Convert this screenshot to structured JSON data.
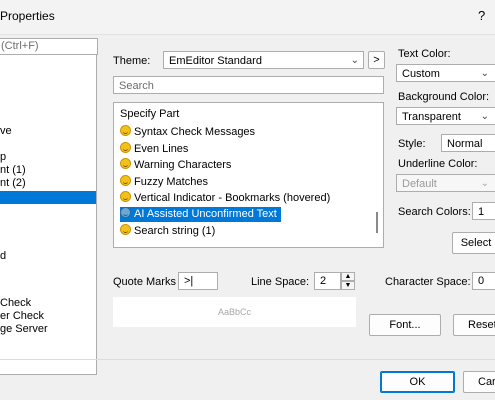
{
  "window": {
    "title": "Properties",
    "help": "?"
  },
  "left_panel": {
    "search_placeholder": "(Ctrl+F)",
    "items": [
      "ve",
      "p",
      "nt (1)",
      "nt (2)",
      "",
      "d",
      "Check",
      "er Check",
      "ge Server"
    ]
  },
  "theme": {
    "label": "Theme:",
    "value": "EmEditor Standard",
    "nav_button": ">"
  },
  "search": {
    "placeholder": "Search"
  },
  "specify_part": {
    "label": "Specify Part",
    "items": [
      "Syntax Check Messages",
      "Even Lines",
      "Warning Characters",
      "Fuzzy Matches",
      "Vertical Indicator - Bookmarks (hovered)",
      "AI Assisted Unconfirmed Text",
      "Search string (1)"
    ],
    "selected_index": 5
  },
  "text_color": {
    "label": "Text Color:",
    "value": "Custom"
  },
  "background_color": {
    "label": "Background Color:",
    "value": "Transparent"
  },
  "style": {
    "label": "Style:",
    "value": "Normal"
  },
  "underline_color": {
    "label": "Underline Color:",
    "value": "Default"
  },
  "search_colors": {
    "label": "Search Colors:",
    "value": "1"
  },
  "select_button": "Select",
  "quote_marks": {
    "label": "Quote Marks",
    "value": ">|"
  },
  "line_space": {
    "label": "Line Space:",
    "value": "2"
  },
  "character_space": {
    "label": "Character Space:",
    "value": "0"
  },
  "preview": {
    "text": "AaBbCc"
  },
  "font_button": "Font...",
  "reset_button": "Reset",
  "ok_button": "OK",
  "cancel_button": "Car"
}
